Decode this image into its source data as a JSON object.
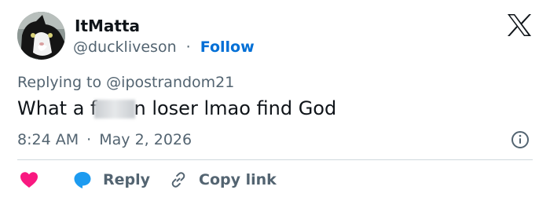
{
  "author": {
    "name": "ItMatta",
    "handle": "@duckliveson",
    "separator": "·",
    "follow_label": "Follow"
  },
  "logo_icon": "x-logo-icon",
  "tweet": {
    "replying_prefix": "Replying to",
    "replying_to": "@ipostrandom21",
    "text_before_censor": "What a f",
    "text_after_censor": "n loser lmao find God",
    "time": "8:24 AM",
    "date_separator": "·",
    "date": "May 2, 2026"
  },
  "actions": {
    "like_icon": "heart-icon",
    "reply_label": "Reply",
    "reply_icon": "speech-bubble-icon",
    "copy_link_label": "Copy link",
    "copy_link_icon": "link-icon",
    "info_icon": "info-icon"
  },
  "colors": {
    "link_blue": "#006fd6",
    "heart_pink": "#f91880",
    "reply_blue": "#1d9bf0",
    "secondary_text": "#536471",
    "primary_text": "#0f1419",
    "divider": "#cfd9de"
  }
}
